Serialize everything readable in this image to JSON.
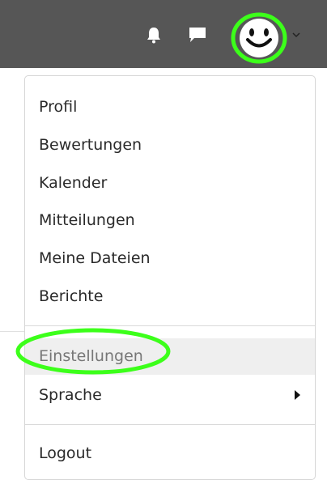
{
  "header": {
    "icons": [
      "bell-icon",
      "chat-icon",
      "avatar",
      "chevron-down-icon"
    ],
    "background_color": "#565656",
    "highlight_color": "#3cff1a"
  },
  "user_menu": {
    "items": [
      {
        "label": "Profil"
      },
      {
        "label": "Bewertungen"
      },
      {
        "label": "Kalender"
      },
      {
        "label": "Mitteilungen"
      },
      {
        "label": "Meine Dateien"
      },
      {
        "label": "Berichte"
      },
      {
        "label": "Einstellungen",
        "state": "hovered"
      },
      {
        "label": "Sprache",
        "has_submenu": true
      },
      {
        "label": "Logout"
      }
    ]
  }
}
